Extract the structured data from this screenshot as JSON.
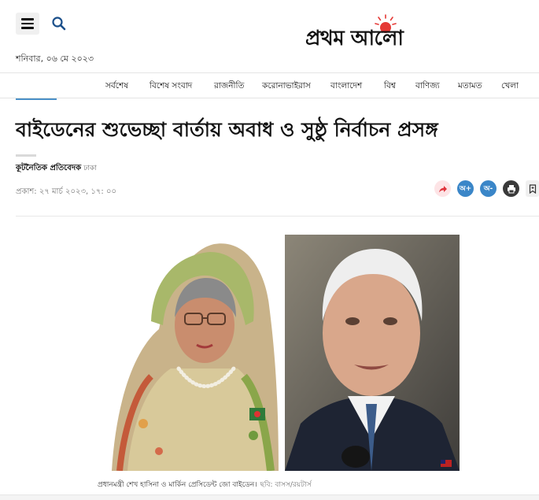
{
  "header": {
    "date": "শনিবার, ০৬ মে ২০২৩",
    "logo": "প্রথম আলো"
  },
  "nav": {
    "items": [
      "সর্বশেষ",
      "বিশেষ সংবাদ",
      "রাজনীতি",
      "করোনাভাইরাস",
      "বাংলাদেশ",
      "বিশ্ব",
      "বাণিজ্য",
      "মতামত",
      "খেলা"
    ]
  },
  "article": {
    "headline": "বাইডেনের শুভেচ্ছা বার্তায় অবাধ ও সুষ্ঠু নির্বাচন প্রসঙ্গ",
    "author": "কূটনৈতিক প্রতিবেদক",
    "place": "ঢাকা",
    "published": "প্রকাশ: ২৭ মার্চ ২০২৩, ১৭: ০০",
    "share_buttons": {
      "font_plus": "অ+",
      "font_minus": "অ-"
    },
    "caption": "প্রধানমন্ত্রী শেখ হাসিনা ও মার্কিন প্রেসিডেন্ট জো বাইডেন।",
    "credit": "ছবি: বাসস/রয়টার্স"
  },
  "colors": {
    "logo_sun": "#e53935",
    "accent": "#4a90c8",
    "share_red": "#e0343c"
  }
}
